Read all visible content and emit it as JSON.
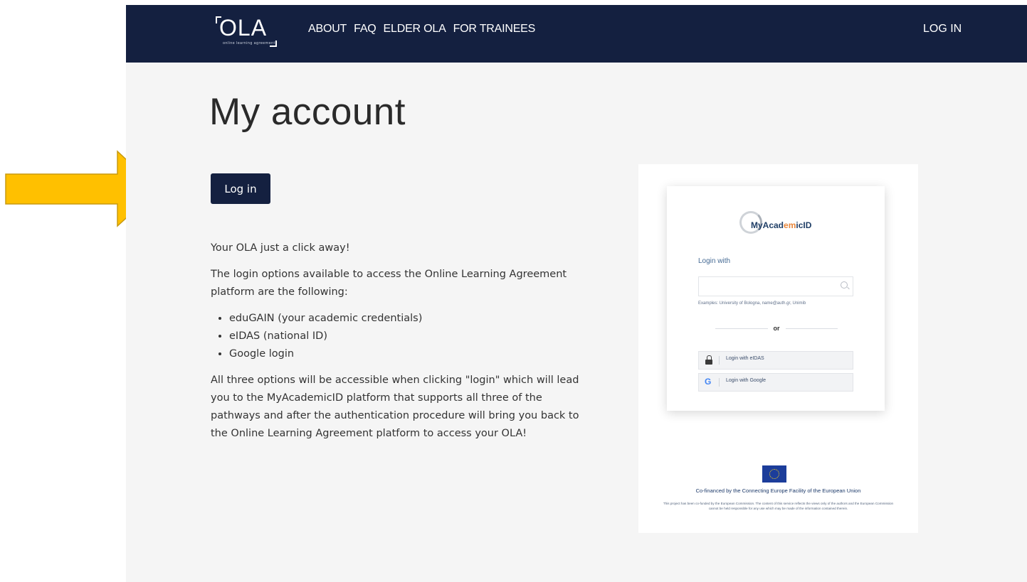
{
  "nav": {
    "logo_text": "OLA",
    "logo_tagline": "online learning agreement",
    "links": [
      "ABOUT",
      "FAQ",
      "ELDER OLA",
      "FOR TRAINEES"
    ],
    "login": "LOG IN"
  },
  "annotation": {
    "arrow_color": "#FFC000",
    "arrow_icon": "arrow-right-icon"
  },
  "main": {
    "title": "My account",
    "login_button": "Log in",
    "intro": "Your OLA just a click away!",
    "options_intro": "The login options available to access the Online Learning Agreement platform are the following:",
    "options": [
      "eduGAIN (your academic credentials)",
      "eIDAS (national ID)",
      "Google login"
    ],
    "closing": "All three options will be accessible when clicking \"login\" which will lead you to the MyAcademicID platform that supports all three of the pathways and after the authentication procedure will bring you back to the Online Learning Agreement platform to access your OLA!"
  },
  "preview": {
    "brand_prefix": "MyAcad",
    "brand_accent": "em",
    "brand_suffix": "icID",
    "login_with": "Login with",
    "examples": "Examples: University of Bologna, name@auth.gr, Unimib",
    "or": "or",
    "eidas_label": "Login with eIDAS",
    "google_label": "Login with Google",
    "google_glyph": "G",
    "cofinanced": "Co-financed by the Connecting Europe Facility of the European Union",
    "disclaimer": "This project has been co-funded by the European Commission. The content of this service reflects the views only of the authors and the European Commission cannot be held responsible for any use which may be made of the information contained therein."
  },
  "colors": {
    "navbar": "#142040",
    "page_bg": "#f5f5f5",
    "button": "#142040",
    "arrow": "#FFC000",
    "brand_accent": "#e8863b"
  }
}
